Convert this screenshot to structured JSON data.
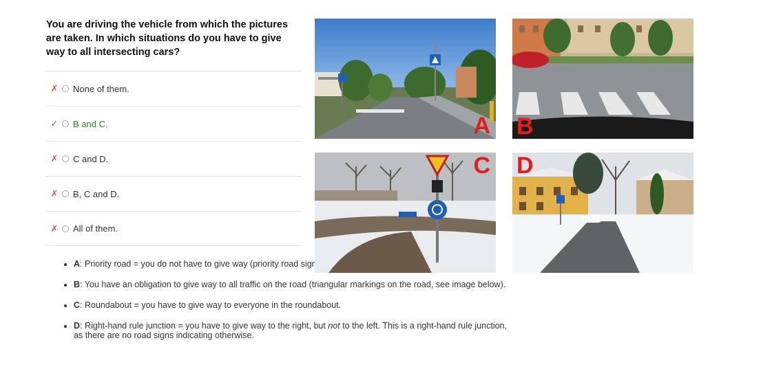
{
  "question": "You are driving the vehicle from which the pictures are taken. In which situations do you have to give way to all intersecting cars?",
  "options": [
    {
      "label": "None of them.",
      "status": "wrong"
    },
    {
      "label": "B and C.",
      "status": "correct"
    },
    {
      "label": "C and D.",
      "status": "wrong"
    },
    {
      "label": "B, C and D.",
      "status": "wrong"
    },
    {
      "label": "All of them.",
      "status": "wrong"
    }
  ],
  "marks": {
    "wrong": "✗",
    "correct": "✓"
  },
  "explanations": [
    {
      "key": "A",
      "text": ": Priority road = you do not have to give way (priority road sign, see image below)."
    },
    {
      "key": "B",
      "text": ": You have an obligation to give way to all traffic on the road (triangular markings on the road, see image below)."
    },
    {
      "key": "C",
      "text": ": Roundabout = you have to give way to everyone in the roundabout."
    },
    {
      "key": "D",
      "text_before": ": Right-hand rule junction = you have to give way to the right, but ",
      "text_em": "not",
      "text_after": " to the left. This is a right-hand rule junction, as there are no road signs indicating otherwise."
    }
  ],
  "photos": {
    "a": "A",
    "b": "B",
    "c": "C",
    "d": "D"
  },
  "colors": {
    "wrong": "#d9534f",
    "correct": "#3c8a3c",
    "photo_letter": "#e02020"
  }
}
